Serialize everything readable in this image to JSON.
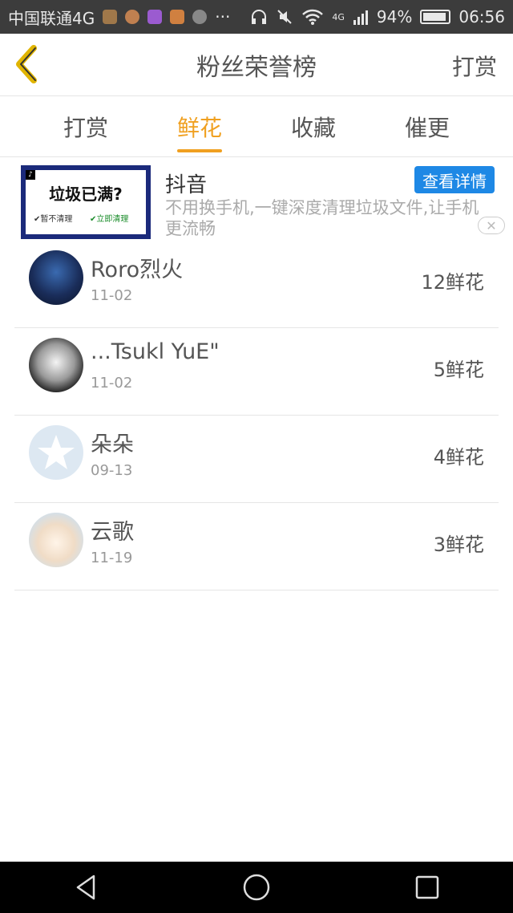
{
  "status_bar": {
    "carrier": "中国联通4G",
    "network": "4G",
    "battery": "94%",
    "time": "06:56",
    "more": "···"
  },
  "header": {
    "title": "粉丝荣誉榜",
    "right_action": "打赏"
  },
  "tabs": [
    {
      "label": "打赏",
      "active": false
    },
    {
      "label": "鲜花",
      "active": true
    },
    {
      "label": "收藏",
      "active": false
    },
    {
      "label": "催更",
      "active": false
    }
  ],
  "ad": {
    "image_title": "垃圾已满?",
    "image_option1": "✔暂不清理",
    "image_option2": "✔立即清理",
    "title": "抖音",
    "button": "查看详情",
    "description": "不用换手机,一键深度清理垃圾文件,让手机更流畅",
    "close": "✕"
  },
  "fans": [
    {
      "name": "Roro烈火",
      "date": "11-02",
      "count": "12鲜花"
    },
    {
      "name": "...Tsukl YuE\"",
      "date": "11-02",
      "count": "5鲜花"
    },
    {
      "name": "朵朵",
      "date": "09-13",
      "count": "4鲜花"
    },
    {
      "name": "云歌",
      "date": "11-19",
      "count": "3鲜花"
    }
  ],
  "colors": {
    "accent": "#f0a020",
    "ad_button": "#1e88e5",
    "status_bar": "#3c3c3c"
  }
}
